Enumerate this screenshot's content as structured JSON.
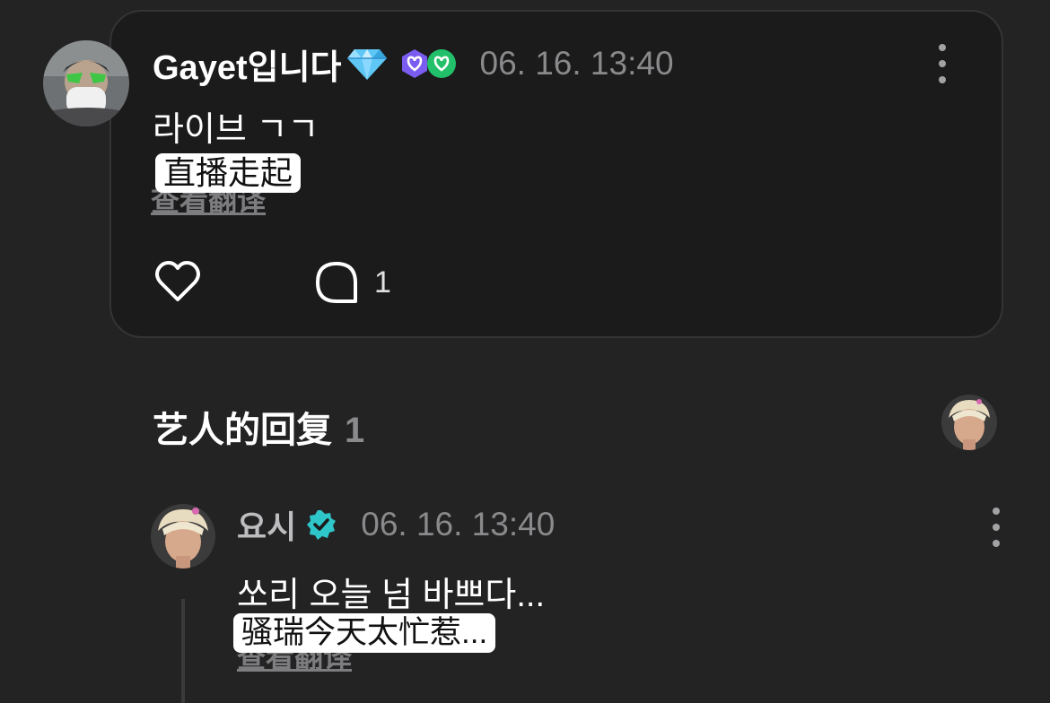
{
  "post": {
    "author": "Gayet입니다",
    "timestamp": "06. 16. 13:40",
    "text": "라이브 ㄱㄱ",
    "translation_overlay": "直播走起",
    "translate_link": "查看翻译",
    "comment_count": "1",
    "icons": {
      "author_badge": "diamond-icon",
      "membership_badges": [
        "purple-heart-badge-icon",
        "green-heart-badge-icon"
      ],
      "more": "more-vertical-icon",
      "like": "heart-icon",
      "comment": "comment-bubble-icon"
    }
  },
  "artist_replies": {
    "title": "艺人的回复",
    "count": "1"
  },
  "reply": {
    "author": "요시",
    "timestamp": "06. 16. 13:40",
    "text": "쏘리 오늘 넘 바쁘다...",
    "translation_overlay": "骚瑞今天太忙惹...",
    "translate_link": "查看翻译",
    "icons": {
      "verified": "verified-badge-icon",
      "more": "more-vertical-icon"
    }
  },
  "colors": {
    "background": "#232324",
    "card": "#1b1b1c",
    "muted_text": "#8a8a8c",
    "verified": "#2fc6c9",
    "badge_purple": "#7b5cf0",
    "badge_green": "#22c06a",
    "diamond": "#5fc7f5"
  }
}
